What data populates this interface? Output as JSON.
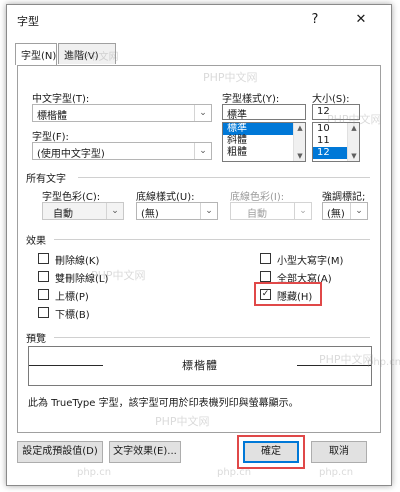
{
  "dialog": {
    "title": "字型",
    "help_icon": "?",
    "close_icon": "✕"
  },
  "tabs": [
    {
      "label": "字型(N)",
      "active": true
    },
    {
      "label": "進階(V)",
      "active": false
    }
  ],
  "font": {
    "asian_font_label": "中文字型(T):",
    "asian_font_value": "標楷體",
    "western_font_label": "字型(F):",
    "western_font_value": "(使用中文字型)",
    "style_label": "字型樣式(Y):",
    "style_value": "標準",
    "style_options": [
      "標準",
      "斜體",
      "粗體"
    ],
    "style_selected": "標準",
    "size_label": "大小(S):",
    "size_value": "12",
    "size_options": [
      "10",
      "11",
      "12"
    ],
    "size_selected": "12"
  },
  "all_text": {
    "section_label": "所有文字",
    "color_label": "字型色彩(C):",
    "color_value": "自動",
    "underline_style_label": "底線樣式(U):",
    "underline_style_value": "(無)",
    "underline_color_label": "底線色彩(I):",
    "underline_color_value": "自動",
    "emphasis_label": "強調標記;",
    "emphasis_value": "(無)"
  },
  "effects": {
    "section_label": "效果",
    "items": [
      {
        "label": "刪除線(K)",
        "checked": false
      },
      {
        "label": "雙刪除線(L)",
        "checked": false
      },
      {
        "label": "上標(P)",
        "checked": false
      },
      {
        "label": "下標(B)",
        "checked": false
      },
      {
        "label": "小型大寫字(M)",
        "checked": false
      },
      {
        "label": "全部大寫(A)",
        "checked": false
      },
      {
        "label": "隱藏(H)",
        "checked": true
      }
    ],
    "check_mark": "✓"
  },
  "preview": {
    "section_label": "預覽",
    "sample_text": "標楷體",
    "description": "此為 TrueType 字型，該字型可用於印表機列印與螢幕顯示。"
  },
  "buttons": {
    "set_default": "設定成預設值(D)",
    "text_effects": "文字效果(E)...",
    "ok": "確定",
    "cancel": "取消"
  },
  "icons": {
    "dropdown": "⌄",
    "scroll_up": "▲",
    "scroll_down": "▼"
  },
  "watermarks": {
    "brand": "PHP中文网",
    "domain": "php.cn"
  },
  "colors": {
    "selection": "#0078d7",
    "highlight_box": "#e04848"
  }
}
